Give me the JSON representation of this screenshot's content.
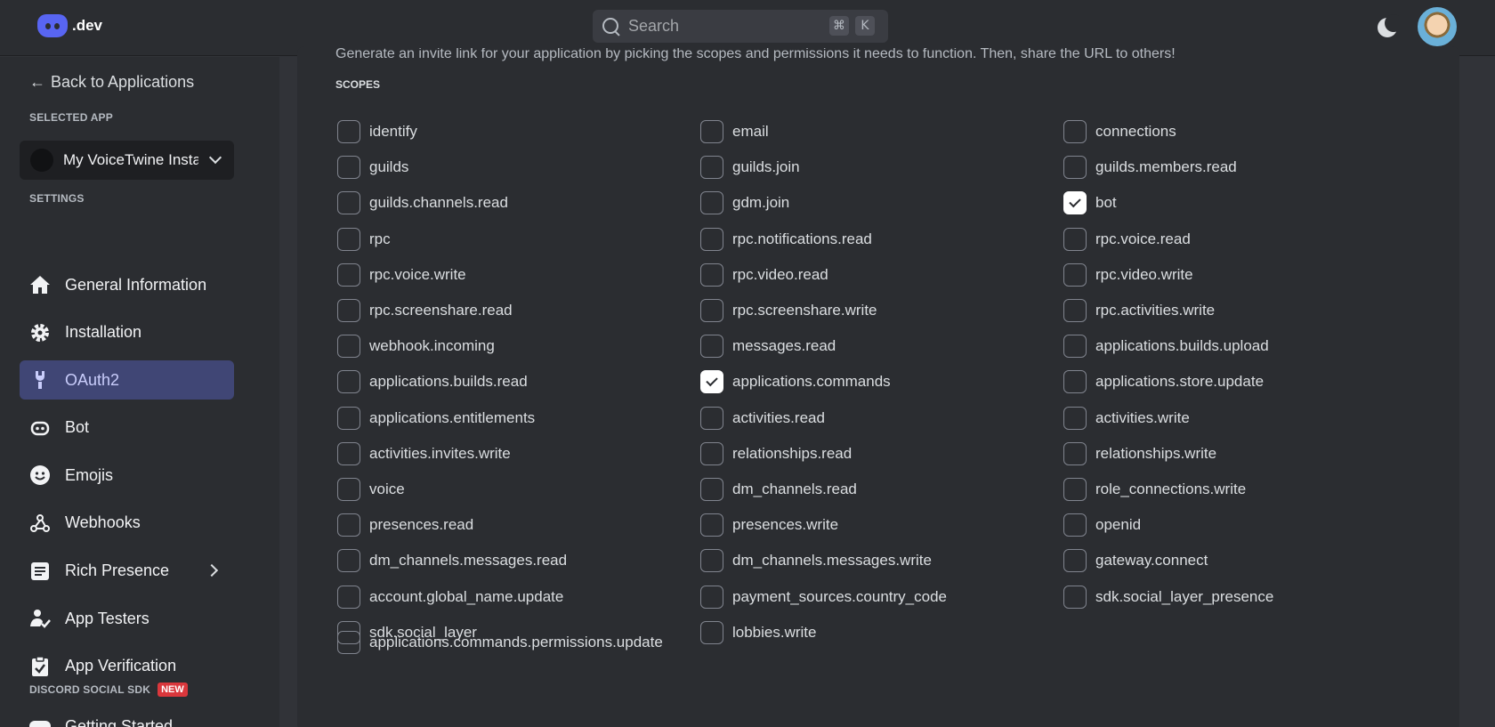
{
  "topbar": {
    "logo_text": ".dev",
    "search_placeholder": "Search",
    "shortcut_cmd": "⌘",
    "shortcut_key": "K"
  },
  "sidebar": {
    "back_label": "Back to Applications",
    "selected_app_label": "SELECTED APP",
    "app_name": "My VoiceTwine Insta",
    "settings_label": "SETTINGS",
    "items": [
      {
        "label": "General Information",
        "icon": "home-icon"
      },
      {
        "label": "Installation",
        "icon": "gear-icon"
      },
      {
        "label": "OAuth2",
        "icon": "wrench-icon",
        "active": true
      },
      {
        "label": "Bot",
        "icon": "robot-icon"
      },
      {
        "label": "Emojis",
        "icon": "smiley-icon"
      },
      {
        "label": "Webhooks",
        "icon": "webhook-icon"
      },
      {
        "label": "Rich Presence",
        "icon": "document-icon"
      },
      {
        "label": "App Testers",
        "icon": "user-check-icon"
      },
      {
        "label": "App Verification",
        "icon": "clipboard-check-icon"
      }
    ],
    "sdk_label": "DISCORD SOCIAL SDK",
    "sdk_badge": "NEW",
    "getting_started": "Getting Started"
  },
  "main": {
    "description": "Generate an invite link for your application by picking the scopes and permissions it needs to function. Then, share the URL to others!",
    "scopes_title": "SCOPES",
    "scopes_col1": [
      {
        "label": "identify",
        "checked": false
      },
      {
        "label": "guilds",
        "checked": false
      },
      {
        "label": "guilds.channels.read",
        "checked": false
      },
      {
        "label": "rpc",
        "checked": false
      },
      {
        "label": "rpc.voice.write",
        "checked": false
      },
      {
        "label": "rpc.screenshare.read",
        "checked": false
      },
      {
        "label": "webhook.incoming",
        "checked": false
      },
      {
        "label": "applications.builds.read",
        "checked": false
      },
      {
        "label": "applications.entitlements",
        "checked": false
      },
      {
        "label": "activities.invites.write",
        "checked": false
      },
      {
        "label": "voice",
        "checked": false
      },
      {
        "label": "presences.read",
        "checked": false
      },
      {
        "label": "dm_channels.messages.read",
        "checked": false
      },
      {
        "label": "account.global_name.update",
        "checked": false
      },
      {
        "label": "sdk.social_layer",
        "checked": false
      }
    ],
    "scopes_col2": [
      {
        "label": "email",
        "checked": false
      },
      {
        "label": "guilds.join",
        "checked": false
      },
      {
        "label": "gdm.join",
        "checked": false
      },
      {
        "label": "rpc.notifications.read",
        "checked": false
      },
      {
        "label": "rpc.video.read",
        "checked": false
      },
      {
        "label": "rpc.screenshare.write",
        "checked": false
      },
      {
        "label": "messages.read",
        "checked": false
      },
      {
        "label": "applications.commands",
        "checked": true
      },
      {
        "label": "activities.read",
        "checked": false
      },
      {
        "label": "relationships.read",
        "checked": false
      },
      {
        "label": "dm_channels.read",
        "checked": false
      },
      {
        "label": "presences.write",
        "checked": false
      },
      {
        "label": "dm_channels.messages.write",
        "checked": false
      },
      {
        "label": "payment_sources.country_code",
        "checked": false
      },
      {
        "label": "lobbies.write",
        "checked": false
      }
    ],
    "scopes_col3": [
      {
        "label": "connections",
        "checked": false
      },
      {
        "label": "guilds.members.read",
        "checked": false
      },
      {
        "label": "bot",
        "checked": true
      },
      {
        "label": "rpc.voice.read",
        "checked": false
      },
      {
        "label": "rpc.video.write",
        "checked": false
      },
      {
        "label": "rpc.activities.write",
        "checked": false
      },
      {
        "label": "applications.builds.upload",
        "checked": false
      },
      {
        "label": "applications.store.update",
        "checked": false
      },
      {
        "label": "activities.write",
        "checked": false
      },
      {
        "label": "relationships.write",
        "checked": false
      },
      {
        "label": "role_connections.write",
        "checked": false
      },
      {
        "label": "openid",
        "checked": false
      },
      {
        "label": "gateway.connect",
        "checked": false
      },
      {
        "label": "sdk.social_layer_presence",
        "checked": false
      }
    ],
    "scope_last": {
      "label": "applications.commands.permissions.update",
      "checked": false
    }
  }
}
